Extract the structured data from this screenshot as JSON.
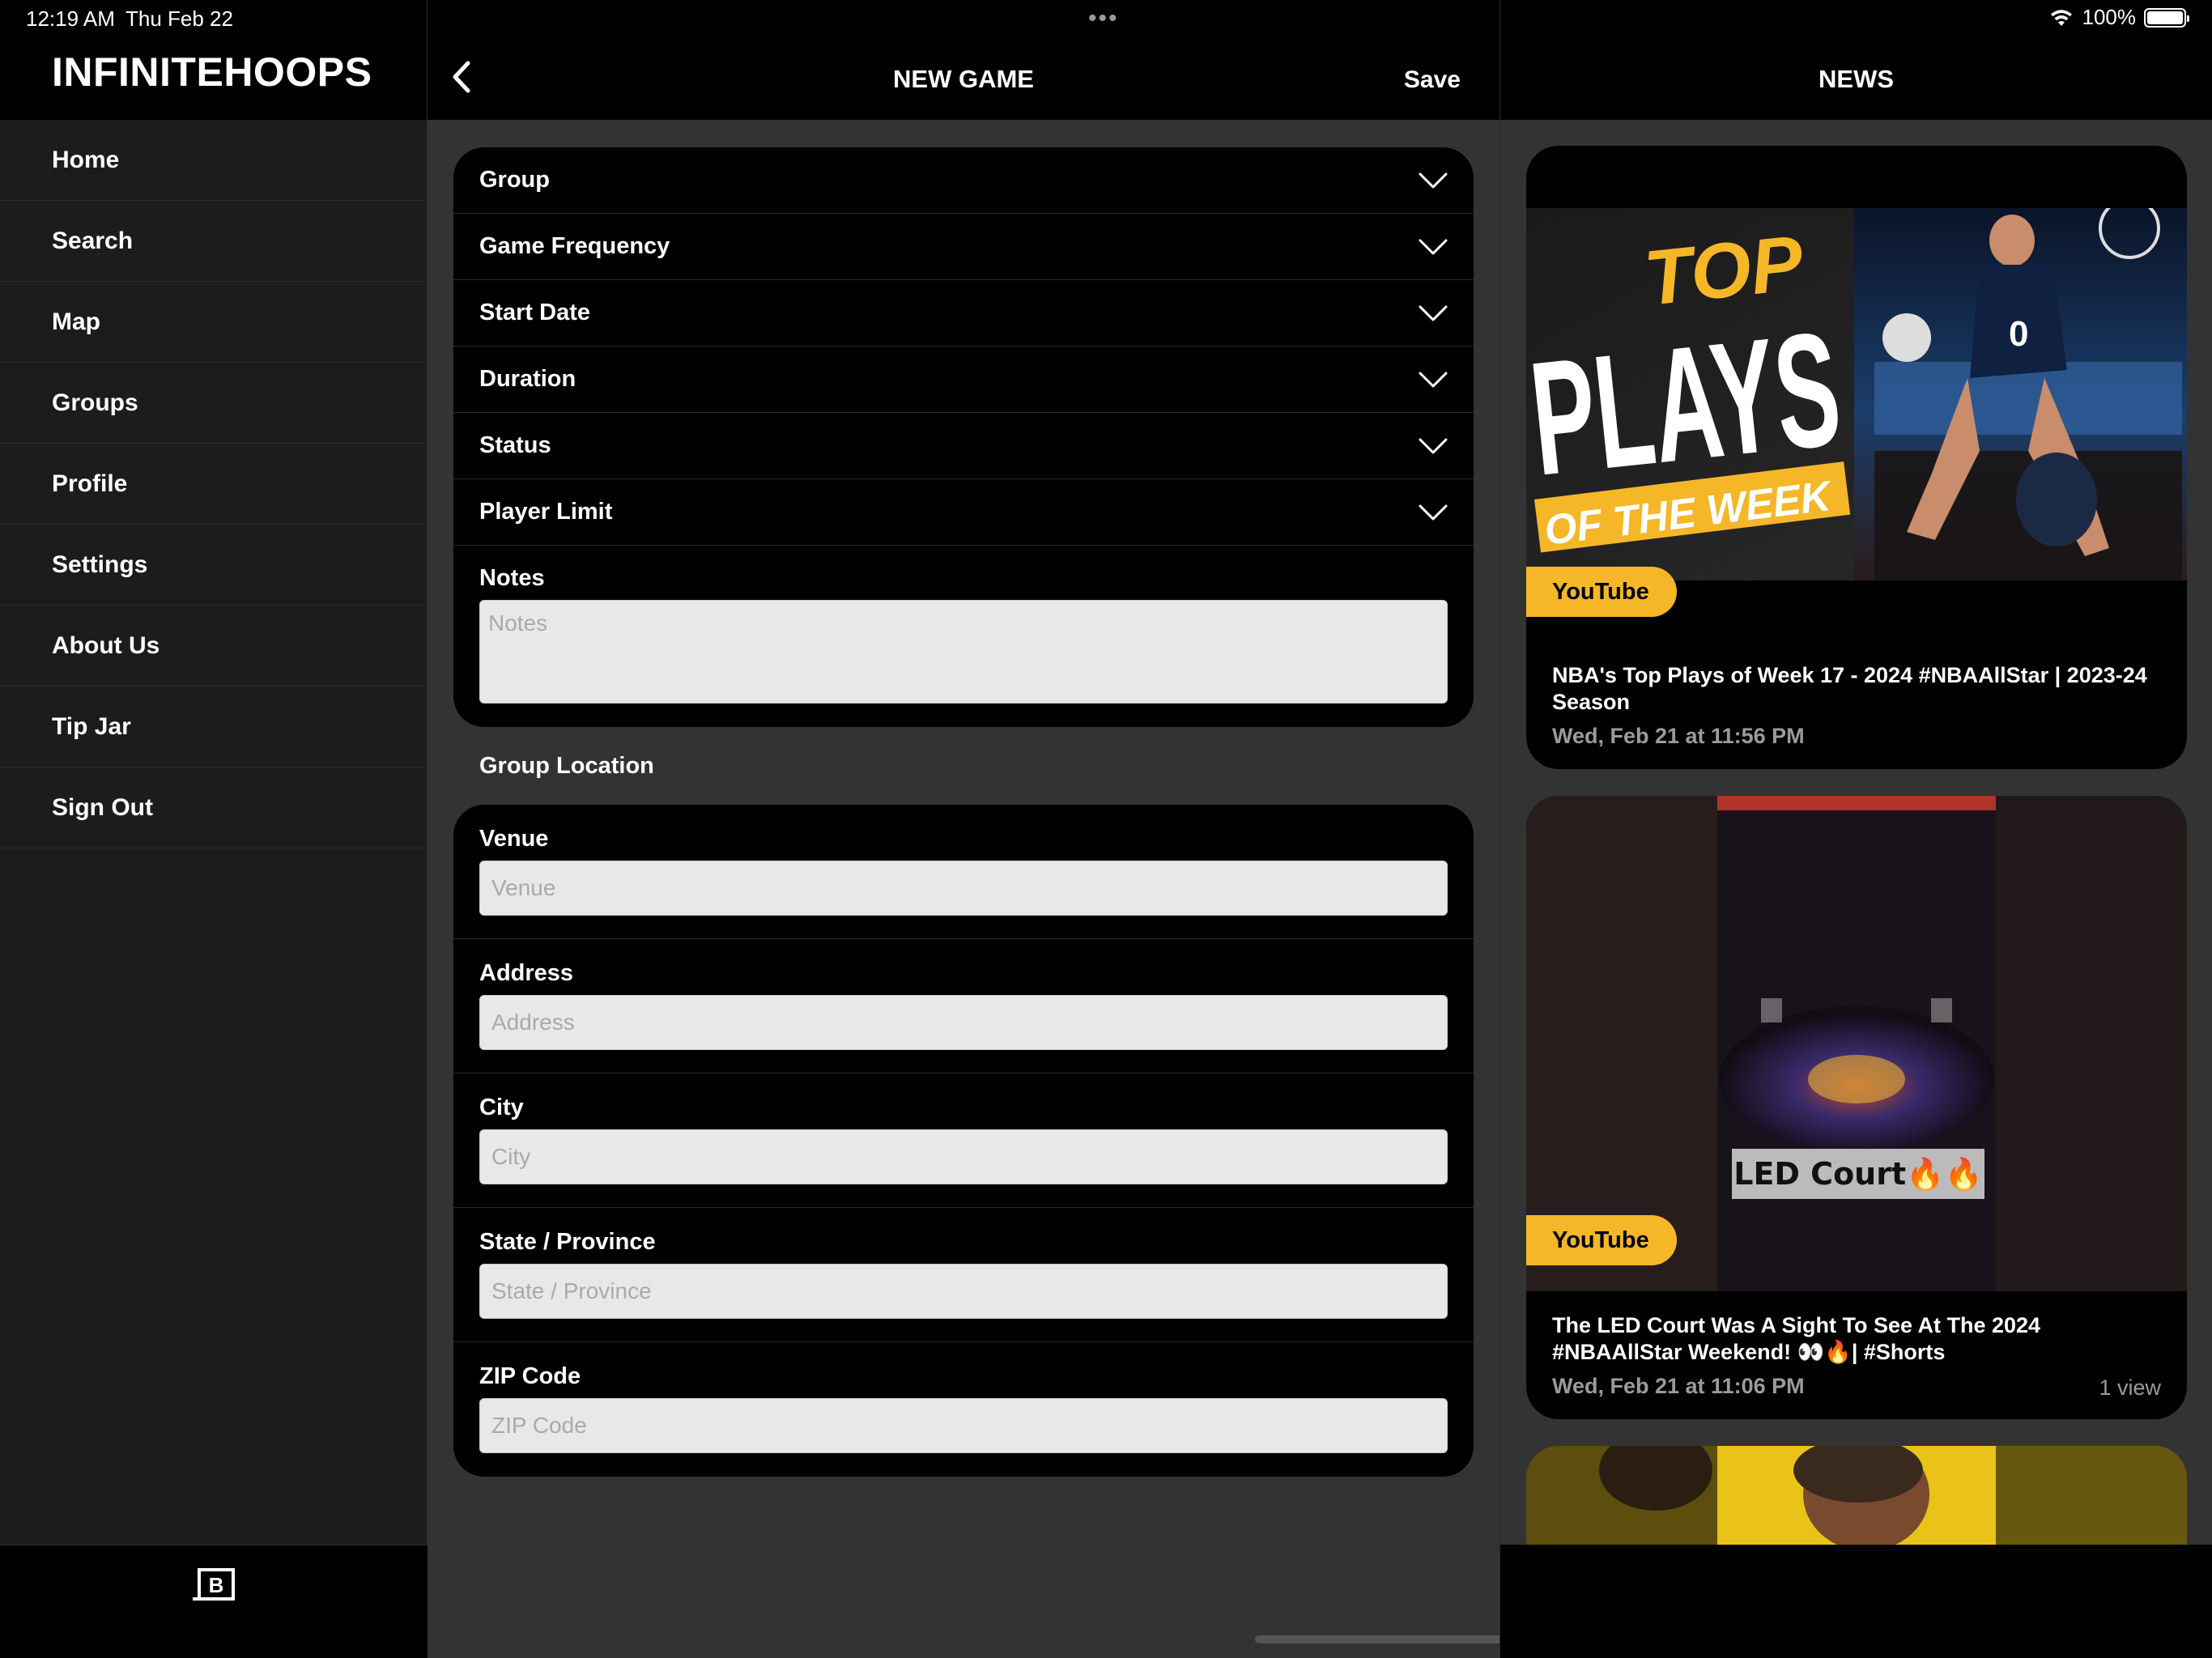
{
  "status_bar": {
    "time": "12:19 AM",
    "date": "Thu Feb 22",
    "dots": "•••",
    "battery": "100%"
  },
  "sidebar": {
    "app_title": "INFINITEHOOPS",
    "items": [
      {
        "label": "Home"
      },
      {
        "label": "Search"
      },
      {
        "label": "Map"
      },
      {
        "label": "Groups"
      },
      {
        "label": "Profile"
      },
      {
        "label": "Settings"
      },
      {
        "label": "About Us"
      },
      {
        "label": "Tip Jar"
      },
      {
        "label": "Sign Out"
      }
    ],
    "footer_icon": "b-logo-icon",
    "footer_icon_letter": "B"
  },
  "form": {
    "title": "NEW GAME",
    "save_label": "Save",
    "dropdowns": [
      {
        "label": "Group"
      },
      {
        "label": "Game Frequency"
      },
      {
        "label": "Start Date"
      },
      {
        "label": "Duration"
      },
      {
        "label": "Status"
      },
      {
        "label": "Player Limit"
      }
    ],
    "notes": {
      "label": "Notes",
      "placeholder": "Notes",
      "value": ""
    },
    "location_section_label": "Group Location",
    "location_fields": [
      {
        "label": "Venue",
        "placeholder": "Venue",
        "value": ""
      },
      {
        "label": "Address",
        "placeholder": "Address",
        "value": ""
      },
      {
        "label": "City",
        "placeholder": "City",
        "value": ""
      },
      {
        "label": "State / Province",
        "placeholder": "State / Province",
        "value": ""
      },
      {
        "label": "ZIP Code",
        "placeholder": "ZIP Code",
        "value": ""
      }
    ]
  },
  "news": {
    "title": "NEWS",
    "items": [
      {
        "source": "YouTube",
        "headline": "NBA's Top Plays of Week 17 - 2024 #NBAAllStar | 2023-24 Season",
        "date": "Wed, Feb 21 at 11:56 PM",
        "views": "",
        "thumbnail_text": {
          "line1": "TOP",
          "line2": "PLAYS",
          "line3": "OF THE WEEK"
        }
      },
      {
        "source": "YouTube",
        "headline": "The LED Court Was A Sight To See At The 2024 #NBAAllStar Weekend! 👀🔥| #Shorts",
        "date": "Wed, Feb 21 at 11:06 PM",
        "views": "1 view",
        "thumbnail_text": {
          "caption": "LED Court🔥🔥"
        }
      }
    ]
  },
  "colors": {
    "accent_yellow": "#f5b728",
    "panel_bg": "#333333",
    "card_bg": "#000000",
    "sidebar_bg": "#1c1c1c"
  }
}
